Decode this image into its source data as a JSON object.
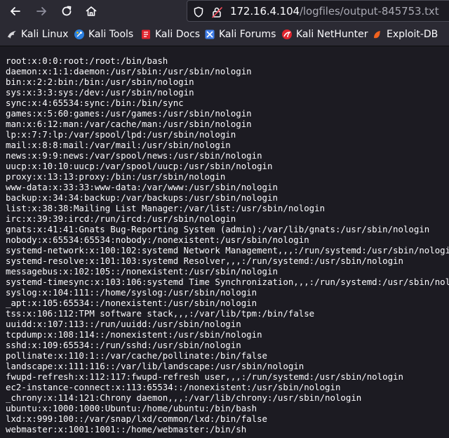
{
  "browser": {
    "url_host": "172.16.4.104",
    "url_path": "/logfiles/output-845753.txt"
  },
  "bookmarks": [
    {
      "label": "Kali Linux",
      "icon": "kali-dragon-icon",
      "color": "#d7d7db"
    },
    {
      "label": "Kali Tools",
      "icon": "kali-tools-icon",
      "color": "#2b7fe0"
    },
    {
      "label": "Kali Docs",
      "icon": "kali-docs-icon",
      "color": "#e0242d"
    },
    {
      "label": "Kali Forums",
      "icon": "kali-forums-icon",
      "color": "#3f7de8"
    },
    {
      "label": "Kali NetHunter",
      "icon": "kali-nethunter-icon",
      "color": "#e0242d"
    },
    {
      "label": "Exploit-DB",
      "icon": "exploit-db-icon",
      "color": "#f0621e"
    }
  ],
  "file_lines": [
    "root:x:0:0:root:/root:/bin/bash",
    "daemon:x:1:1:daemon:/usr/sbin:/usr/sbin/nologin",
    "bin:x:2:2:bin:/bin:/usr/sbin/nologin",
    "sys:x:3:3:sys:/dev:/usr/sbin/nologin",
    "sync:x:4:65534:sync:/bin:/bin/sync",
    "games:x:5:60:games:/usr/games:/usr/sbin/nologin",
    "man:x:6:12:man:/var/cache/man:/usr/sbin/nologin",
    "lp:x:7:7:lp:/var/spool/lpd:/usr/sbin/nologin",
    "mail:x:8:8:mail:/var/mail:/usr/sbin/nologin",
    "news:x:9:9:news:/var/spool/news:/usr/sbin/nologin",
    "uucp:x:10:10:uucp:/var/spool/uucp:/usr/sbin/nologin",
    "proxy:x:13:13:proxy:/bin:/usr/sbin/nologin",
    "www-data:x:33:33:www-data:/var/www:/usr/sbin/nologin",
    "backup:x:34:34:backup:/var/backups:/usr/sbin/nologin",
    "list:x:38:38:Mailing List Manager:/var/list:/usr/sbin/nologin",
    "irc:x:39:39:ircd:/run/ircd:/usr/sbin/nologin",
    "gnats:x:41:41:Gnats Bug-Reporting System (admin):/var/lib/gnats:/usr/sbin/nologin",
    "nobody:x:65534:65534:nobody:/nonexistent:/usr/sbin/nologin",
    "systemd-network:x:100:102:systemd Network Management,,,:/run/systemd:/usr/sbin/nologin",
    "systemd-resolve:x:101:103:systemd Resolver,,,:/run/systemd:/usr/sbin/nologin",
    "messagebus:x:102:105::/nonexistent:/usr/sbin/nologin",
    "systemd-timesync:x:103:106:systemd Time Synchronization,,,:/run/systemd:/usr/sbin/nologin",
    "syslog:x:104:111::/home/syslog:/usr/sbin/nologin",
    "_apt:x:105:65534::/nonexistent:/usr/sbin/nologin",
    "tss:x:106:112:TPM software stack,,,:/var/lib/tpm:/bin/false",
    "uuidd:x:107:113::/run/uuidd:/usr/sbin/nologin",
    "tcpdump:x:108:114::/nonexistent:/usr/sbin/nologin",
    "sshd:x:109:65534::/run/sshd:/usr/sbin/nologin",
    "pollinate:x:110:1::/var/cache/pollinate:/bin/false",
    "landscape:x:111:116::/var/lib/landscape:/usr/sbin/nologin",
    "fwupd-refresh:x:112:117:fwupd-refresh user,,,:/run/systemd:/usr/sbin/nologin",
    "ec2-instance-connect:x:113:65534::/nonexistent:/usr/sbin/nologin",
    "_chrony:x:114:121:Chrony daemon,,,:/var/lib/chrony:/usr/sbin/nologin",
    "ubuntu:x:1000:1000:Ubuntu:/home/ubuntu:/bin/bash",
    "lxd:x:999:100::/var/snap/lxd/common/lxd:/bin/false",
    "webmaster:x:1001:1001::/home/webmaster:/bin/sh"
  ]
}
